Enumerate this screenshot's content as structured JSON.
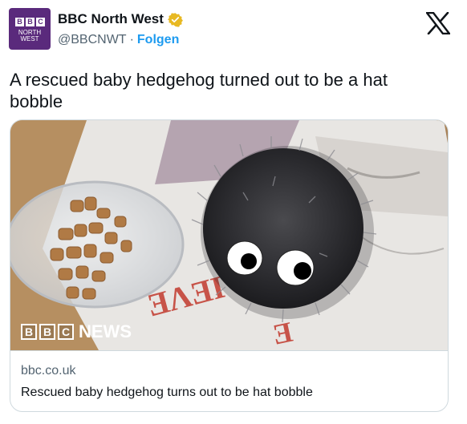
{
  "account": {
    "display_name": "BBC North West",
    "handle": "@BBCNWT",
    "separator": "·",
    "follow_label": "Folgen",
    "avatar_letters": [
      "B",
      "B",
      "C"
    ],
    "avatar_line1": "NORTH",
    "avatar_line2": "WEST",
    "avatar_color": "#5a2a7c",
    "verified_color": "#e8b923"
  },
  "tweet": {
    "text": "A rescued baby hedgehog turned out to be a hat bobble"
  },
  "card": {
    "image_logo_letters": [
      "B",
      "B",
      "C"
    ],
    "image_logo_word": "NEWS",
    "domain": "bbc.co.uk",
    "title": "Rescued baby hedgehog turns out to be hat bobble"
  },
  "colors": {
    "link": "#1d9bf0",
    "secondary_text": "#536471",
    "border": "#cfd9de"
  }
}
